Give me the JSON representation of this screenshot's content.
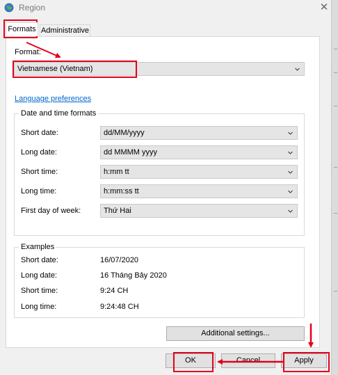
{
  "window": {
    "title": "Region"
  },
  "tabs": [
    {
      "label": "Formats"
    },
    {
      "label": "Administrative"
    }
  ],
  "format": {
    "label": "Format:",
    "value": "Vietnamese (Vietnam)"
  },
  "language_link": "Language preferences",
  "date_time": {
    "title": "Date and time formats",
    "rows": [
      {
        "label": "Short date:",
        "value": "dd/MM/yyyy"
      },
      {
        "label": "Long date:",
        "value": "dd MMMM yyyy"
      },
      {
        "label": "Short time:",
        "value": "h:mm tt"
      },
      {
        "label": "Long time:",
        "value": "h:mm:ss tt"
      },
      {
        "label": "First day of week:",
        "value": "Thứ Hai"
      }
    ]
  },
  "examples": {
    "title": "Examples",
    "rows": [
      {
        "label": "Short date:",
        "value": "16/07/2020"
      },
      {
        "label": "Long date:",
        "value": "16 Tháng Bảy 2020"
      },
      {
        "label": "Short time:",
        "value": "9:24 CH"
      },
      {
        "label": "Long time:",
        "value": "9:24:48 CH"
      }
    ]
  },
  "buttons": {
    "additional": "Additional settings...",
    "ok": "OK",
    "cancel": "Cancel",
    "apply": "Apply"
  },
  "icons": {
    "title": "globe-icon",
    "close": "close-icon",
    "dropdown": "chevron-down-icon"
  },
  "colors": {
    "highlight": "#e3001b",
    "link": "#0066cc"
  }
}
